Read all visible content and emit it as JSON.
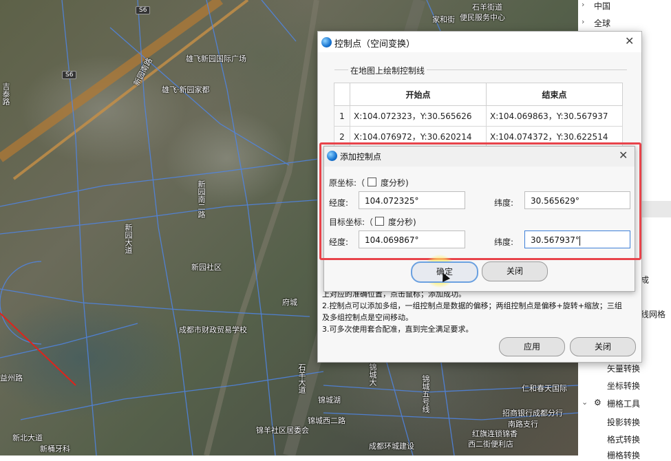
{
  "map": {
    "labels": [
      "石羊街道",
      "便民服务中心",
      "家和街",
      "雄飞新园国际广场",
      "雄飞·新园家都",
      "新园南路",
      "新园南二路",
      "新园大道",
      "新园社区",
      "府城",
      "成都市财政贸易学校",
      "锦城大",
      "锦城湖",
      "锦城西二路",
      "石羊大道",
      "锦城五号线",
      "仁和春天国际",
      "招商银行成都分行",
      "南路支行",
      "红旗连锁锦香",
      "西二街便利店",
      "锦羊社区居委会",
      "成都环城建设",
      "新桶牙科",
      "新北大道",
      "益州路",
      "吉泰路"
    ],
    "badges": [
      "S6",
      "S6"
    ]
  },
  "tree": {
    "items": [
      "中国",
      "全球",
      "成",
      "线网格",
      "矢量转换",
      "坐标转换",
      "栅格工具",
      "投影转换",
      "格式转换",
      "栅格转换"
    ]
  },
  "main_dialog": {
    "title": "控制点（空间变换）",
    "group_label": "在地图上绘制控制线",
    "columns": [
      "开始点",
      "结束点"
    ],
    "rows": [
      {
        "index": "1",
        "start": "X:104.072323，Y:30.565626",
        "end": "X:104.069863，Y:30.567937"
      },
      {
        "index": "2",
        "start": "X:104.076972，Y:30.620214",
        "end": "X:104.074372，Y:30.622514"
      }
    ],
    "help": [
      "上对应的准确位置，点击鼠标；添加成功。",
      "2.控制点可以添加多组，一组控制点是数据的偏移；两组控制点是偏移+旋转+缩放；三组",
      "及多组控制点是空间移动。",
      "3.可多次使用套合配准，直到完全满足要求。"
    ],
    "apply_label": "应用",
    "close_label": "关闭"
  },
  "add_dialog": {
    "title": "添加控制点",
    "source_label": "原坐标:（",
    "target_label": "目标坐标:（",
    "dms_label": "度分秒)",
    "lon_label": "经度:",
    "lat_label": "纬度:",
    "source_lon": "104.072325°",
    "source_lat": "30.565629°",
    "target_lon": "104.069867°",
    "target_lat": "30.567937°",
    "ok_label": "确定",
    "close_label": "关闭"
  },
  "colors": {
    "highlight": "#e8434a",
    "accent": "#1774d1"
  }
}
